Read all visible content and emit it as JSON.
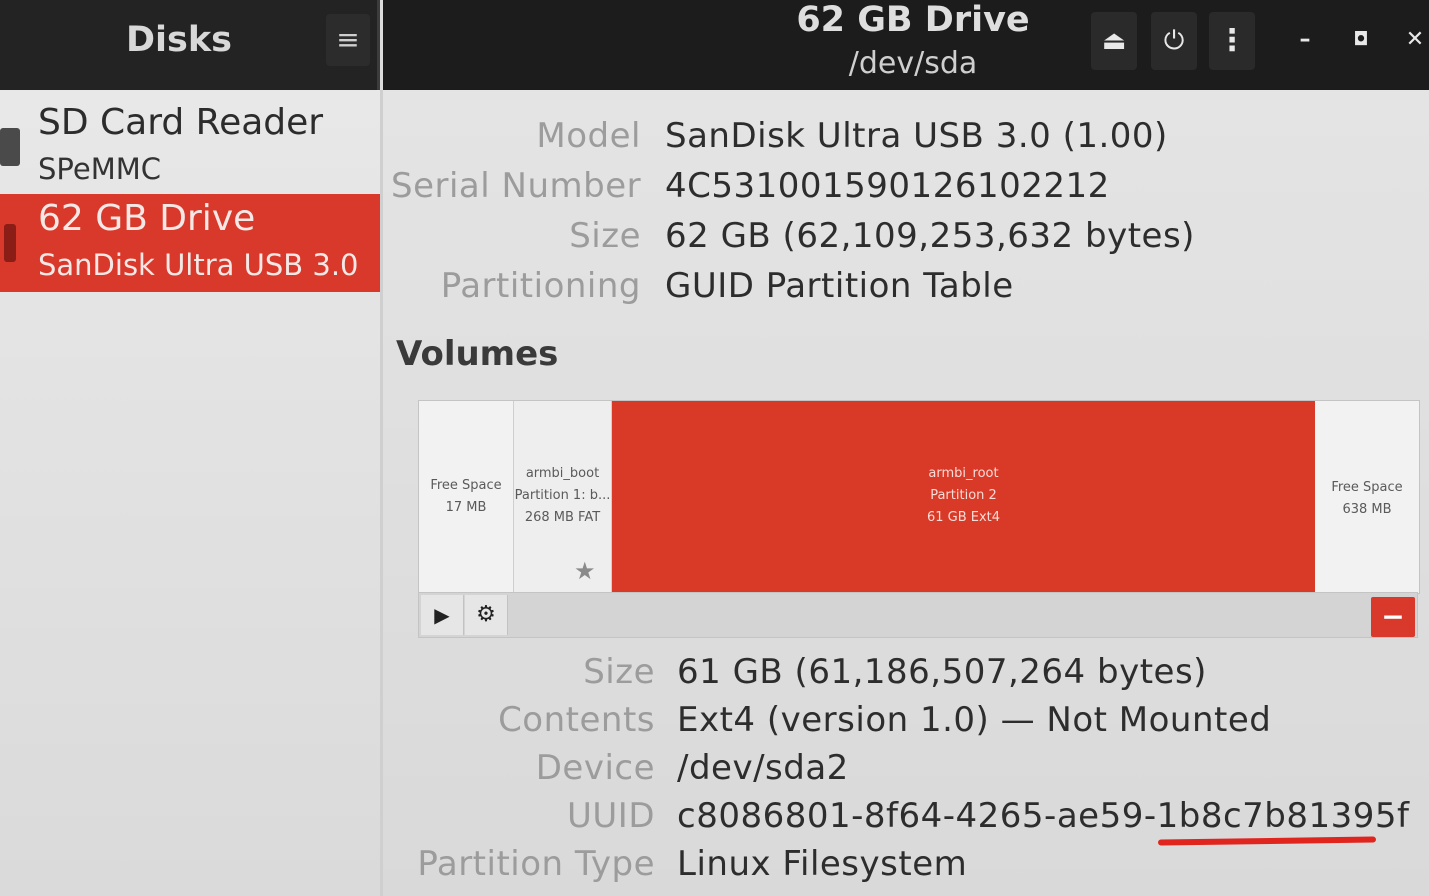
{
  "sidebar": {
    "title": "Disks",
    "menu_icon": "hamburger-menu-icon",
    "devices": [
      {
        "name": "SD Card Reader",
        "subtitle": "SPeMMC",
        "selected": false
      },
      {
        "name": "62 GB Drive",
        "subtitle": "SanDisk Ultra USB 3.0",
        "selected": true
      }
    ]
  },
  "header": {
    "title": "62 GB Drive",
    "device": "/dev/sda",
    "buttons": {
      "eject": "eject-icon",
      "power": "power-icon",
      "more": "more-vertical-icon",
      "eject_glyph": "⏏",
      "power_glyph": "⏻",
      "more_glyph": "⋮"
    },
    "window_controls": {
      "minimize": "–",
      "maximize": "◘",
      "close": "✕"
    }
  },
  "drive": {
    "model_label": "Model",
    "model": "SanDisk Ultra USB 3.0 (1.00)",
    "serial_label": "Serial Number",
    "serial": "4C531001590126102212",
    "size_label": "Size",
    "size": "62 GB (62,109,253,632 bytes)",
    "partitioning_label": "Partitioning",
    "partitioning": "GUID Partition Table"
  },
  "volumes": {
    "heading": "Volumes",
    "segments": [
      {
        "line1": "Free Space",
        "line2": "17 MB"
      },
      {
        "line1": "armbi_boot",
        "line2": "Partition 1: b...",
        "line3": "268 MB FAT"
      },
      {
        "line1": "armbi_root",
        "line2": "Partition 2",
        "line3": "61 GB Ext4"
      },
      {
        "line1": "Free Space",
        "line2": "638 MB"
      }
    ],
    "toolbar": {
      "mount_glyph": "▶",
      "options_glyph": "⚙",
      "delete_glyph": "−"
    },
    "selected": {
      "size_label": "Size",
      "size": "61 GB (61,186,507,264 bytes)",
      "contents_label": "Contents",
      "contents": "Ext4 (version 1.0) — Not Mounted",
      "device_label": "Device",
      "device": "/dev/sda2",
      "uuid_label": "UUID",
      "uuid": "c8086801-8f64-4265-ae59-1b8c7b81395f",
      "type_label": "Partition Type",
      "type": "Linux Filesystem"
    }
  },
  "colors": {
    "accent": "#d9392b",
    "annotation_underline": "#e0241e"
  }
}
